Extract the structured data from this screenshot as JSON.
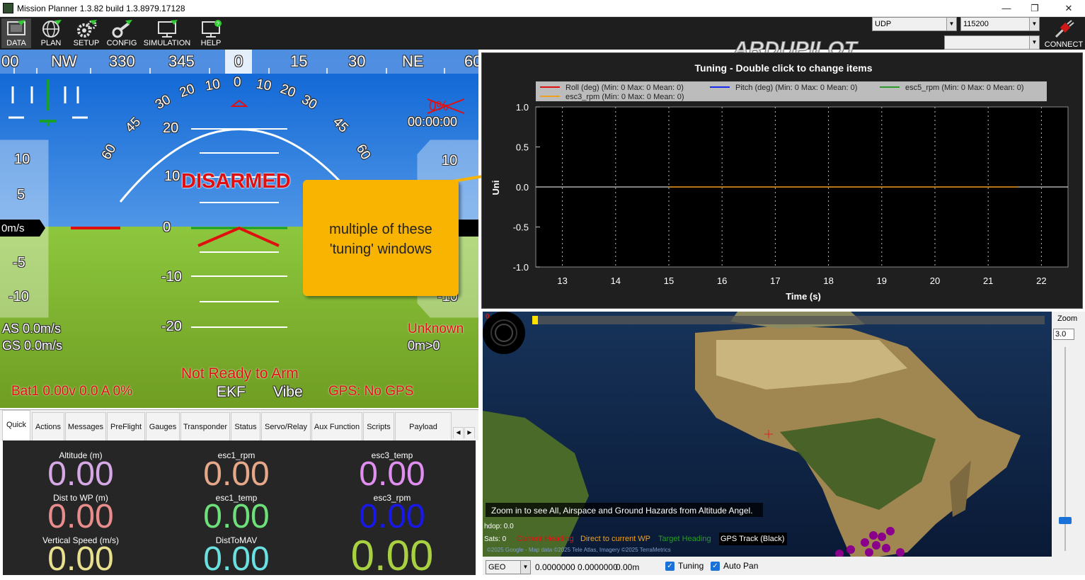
{
  "window": {
    "title": "Mission Planner 1.3.82 build 1.3.8979.17128",
    "minimize": "—",
    "restore": "❐",
    "close": "✕"
  },
  "menu": [
    {
      "label": "DATA",
      "icon": "data-icon"
    },
    {
      "label": "PLAN",
      "icon": "globe-icon"
    },
    {
      "label": "SETUP",
      "icon": "gears-icon"
    },
    {
      "label": "CONFIG",
      "icon": "wrench-icon"
    },
    {
      "label": "SIMULATION",
      "icon": "monitor-icon"
    },
    {
      "label": "HELP",
      "icon": "help-monitor-icon"
    }
  ],
  "logo": "ARDUPILOT",
  "connection": {
    "port": "UDP",
    "baud": "115200",
    "secondary": "",
    "connect_label": "CONNECT"
  },
  "hud": {
    "heading_tape": [
      "00",
      "NW",
      "330",
      "345",
      "0",
      "15",
      "30",
      "NE",
      "60"
    ],
    "roll_labels": [
      "60",
      "45",
      "30",
      "20",
      "10",
      "0",
      "10",
      "20",
      "30",
      "45",
      "60"
    ],
    "pitch_labels": [
      "20",
      "10",
      "0",
      "-10",
      "-20"
    ],
    "speed_labels": [
      "10",
      "5",
      "0m/s",
      "-5",
      "-10"
    ],
    "alt_labels": [
      "10",
      "-10"
    ],
    "status": "DISARMED",
    "battery_pct": "0%",
    "timer": "00:00:00",
    "airspeed": "AS 0.0m/s",
    "groundspeed": "GS 0.0m/s",
    "mode": "Unknown",
    "wp": "0m>0",
    "ready": "Not Ready to Arm",
    "battery": "Bat1 0.00v 0.0 A 0%",
    "ekf": "EKF",
    "vibe": "Vibe",
    "gps": "GPS: No GPS"
  },
  "tabs": [
    "Quick",
    "Actions",
    "Messages",
    "PreFlight",
    "Gauges",
    "Transponder",
    "Status",
    "Servo/Relay",
    "Aux Function",
    "Scripts",
    "Payload Control"
  ],
  "quick": [
    {
      "label": "Altitude (m)",
      "value": "0.00",
      "color": "#d7a8e6"
    },
    {
      "label": "esc1_rpm",
      "value": "0.00",
      "color": "#e7a88a"
    },
    {
      "label": "esc3_temp",
      "value": "0.00",
      "color": "#e08ef0"
    },
    {
      "label": "Dist to WP (m)",
      "value": "0.00",
      "color": "#e88c8c"
    },
    {
      "label": "esc1_temp",
      "value": "0.00",
      "color": "#6ee07a"
    },
    {
      "label": "esc3_rpm",
      "value": "0.00",
      "color": "#1818e8"
    },
    {
      "label": "Vertical Speed (m/s)",
      "value": "0.00",
      "color": "#e8e08e"
    },
    {
      "label": "DistToMAV",
      "value": "0.00",
      "color": "#6ae0e0"
    },
    {
      "label": "",
      "value": "0.00",
      "color": "#a8d040"
    }
  ],
  "tuning_chart": {
    "title": "Tuning - Double click to change items",
    "xlabel": "Time (s)",
    "ylabel": "Uni",
    "legend": [
      {
        "name": "Roll (deg) (Min: 0 Max: 0 Mean: 0)",
        "color": "#e01010"
      },
      {
        "name": "Pitch (deg) (Min: 0 Max: 0 Mean: 0)",
        "color": "#1a2aee"
      },
      {
        "name": "esc5_rpm (Min: 0 Max: 0 Mean: 0)",
        "color": "#2a9a2a"
      },
      {
        "name": "esc3_rpm (Min: 0 Max: 0 Mean: 0)",
        "color": "#f0a020"
      }
    ]
  },
  "chart_data": {
    "type": "line",
    "title": "Tuning - Double click to change items",
    "xlabel": "Time (s)",
    "ylabel": "Uni",
    "xlim": [
      12.5,
      22.5
    ],
    "ylim": [
      -1.0,
      1.0
    ],
    "xticks": [
      "13",
      "14",
      "15",
      "16",
      "17",
      "18",
      "19",
      "20",
      "21",
      "22"
    ],
    "yticks": [
      "1.0",
      "0.5",
      "0.0",
      "-0.5",
      "-1.0"
    ],
    "grid": true,
    "legend_position": "top",
    "series": [
      {
        "name": "esc3_rpm (Min: 0 Max: 0 Mean: 0)",
        "x": [
          15.0,
          21.55
        ],
        "values": [
          0,
          0
        ]
      }
    ]
  },
  "callout": {
    "text_line1": "multiple of these",
    "text_line2": "'tuning' windows"
  },
  "map": {
    "notice": "Zoom in to see All, Airspace and Ground Hazards from Altitude Angel.",
    "hdop": "hdop: 0.0",
    "sats": "Sats: 0",
    "legend_current": "Current Heading",
    "legend_direct": "Direct to current WP",
    "legend_target": "Target Heading",
    "legend_gps": "GPS Track (Black)",
    "copyright": "©2025 Google - Map data ©2025 Tele Atlas, Imagery ©2025 TerraMetrics",
    "red_counter": "0",
    "zoom_label": "Zoom",
    "zoom_value": "3.0"
  },
  "mapbar": {
    "coord_type": "GEO",
    "coords": "0.0000000 0.0000000",
    "alt": "0.00m",
    "tuning_label": "Tuning",
    "autopan_label": "Auto Pan"
  }
}
